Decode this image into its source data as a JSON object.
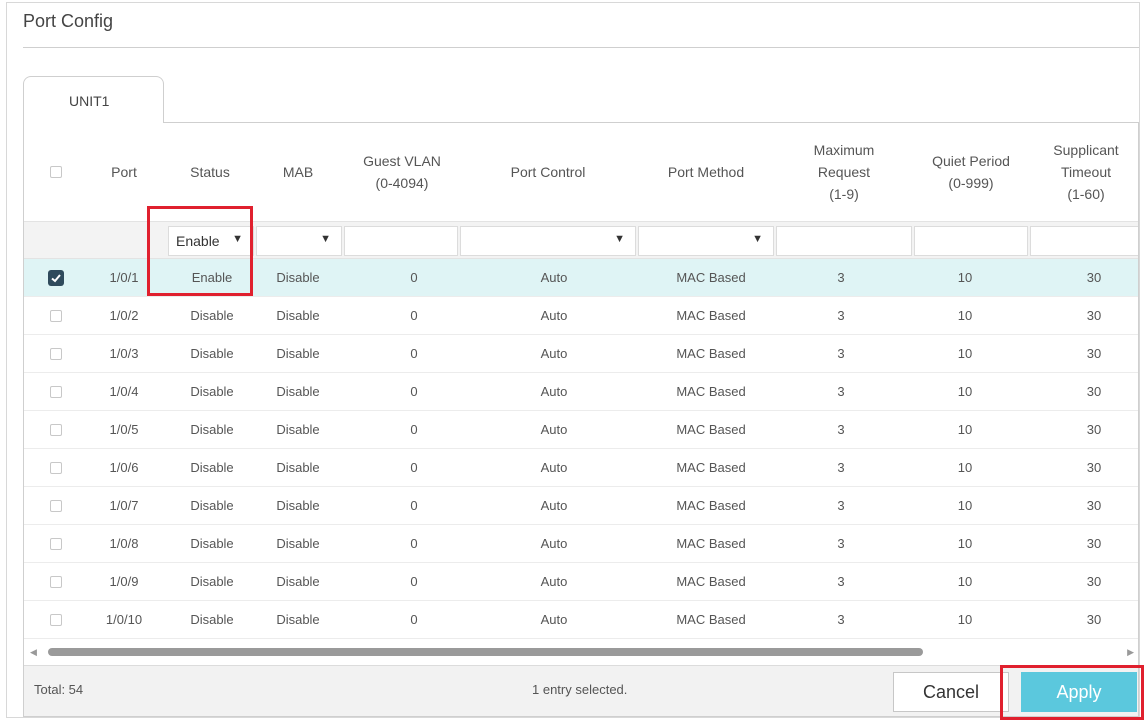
{
  "page": {
    "title": "Port Config"
  },
  "tabs": [
    {
      "label": "UNIT1",
      "active": true
    }
  ],
  "table": {
    "headers": {
      "port": "Port",
      "status": "Status",
      "mab": "MAB",
      "guest_vlan": "Guest VLAN\n(0-4094)",
      "port_control": "Port Control",
      "port_method": "Port Method",
      "max_request": "Maximum\nRequest\n(1-9)",
      "quiet_period": "Quiet Period\n(0-999)",
      "supplicant_timeout": "Supplicant\nTimeout\n(1-60)"
    },
    "filters": {
      "status": "Enable",
      "mab": "",
      "guest_vlan": "",
      "port_control": "",
      "port_method": "",
      "max_request": "",
      "quiet_period": "",
      "supplicant_timeout": ""
    },
    "rows": [
      {
        "checked": true,
        "port": "1/0/1",
        "status": "Enable",
        "mab": "Disable",
        "guest_vlan": "0",
        "port_control": "Auto",
        "port_method": "MAC Based",
        "max_request": "3",
        "quiet_period": "10",
        "supplicant_timeout": "30"
      },
      {
        "checked": false,
        "port": "1/0/2",
        "status": "Disable",
        "mab": "Disable",
        "guest_vlan": "0",
        "port_control": "Auto",
        "port_method": "MAC Based",
        "max_request": "3",
        "quiet_period": "10",
        "supplicant_timeout": "30"
      },
      {
        "checked": false,
        "port": "1/0/3",
        "status": "Disable",
        "mab": "Disable",
        "guest_vlan": "0",
        "port_control": "Auto",
        "port_method": "MAC Based",
        "max_request": "3",
        "quiet_period": "10",
        "supplicant_timeout": "30"
      },
      {
        "checked": false,
        "port": "1/0/4",
        "status": "Disable",
        "mab": "Disable",
        "guest_vlan": "0",
        "port_control": "Auto",
        "port_method": "MAC Based",
        "max_request": "3",
        "quiet_period": "10",
        "supplicant_timeout": "30"
      },
      {
        "checked": false,
        "port": "1/0/5",
        "status": "Disable",
        "mab": "Disable",
        "guest_vlan": "0",
        "port_control": "Auto",
        "port_method": "MAC Based",
        "max_request": "3",
        "quiet_period": "10",
        "supplicant_timeout": "30"
      },
      {
        "checked": false,
        "port": "1/0/6",
        "status": "Disable",
        "mab": "Disable",
        "guest_vlan": "0",
        "port_control": "Auto",
        "port_method": "MAC Based",
        "max_request": "3",
        "quiet_period": "10",
        "supplicant_timeout": "30"
      },
      {
        "checked": false,
        "port": "1/0/7",
        "status": "Disable",
        "mab": "Disable",
        "guest_vlan": "0",
        "port_control": "Auto",
        "port_method": "MAC Based",
        "max_request": "3",
        "quiet_period": "10",
        "supplicant_timeout": "30"
      },
      {
        "checked": false,
        "port": "1/0/8",
        "status": "Disable",
        "mab": "Disable",
        "guest_vlan": "0",
        "port_control": "Auto",
        "port_method": "MAC Based",
        "max_request": "3",
        "quiet_period": "10",
        "supplicant_timeout": "30"
      },
      {
        "checked": false,
        "port": "1/0/9",
        "status": "Disable",
        "mab": "Disable",
        "guest_vlan": "0",
        "port_control": "Auto",
        "port_method": "MAC Based",
        "max_request": "3",
        "quiet_period": "10",
        "supplicant_timeout": "30"
      },
      {
        "checked": false,
        "port": "1/0/10",
        "status": "Disable",
        "mab": "Disable",
        "guest_vlan": "0",
        "port_control": "Auto",
        "port_method": "MAC Based",
        "max_request": "3",
        "quiet_period": "10",
        "supplicant_timeout": "30"
      }
    ]
  },
  "footer": {
    "total": "Total: 54",
    "selection": "1 entry selected.",
    "cancel_label": "Cancel",
    "apply_label": "Apply"
  },
  "icons": {
    "dropdown": "chevron-down-icon",
    "checkbox": "checkbox-icon",
    "scroll_left": "scroll-left-arrow-icon",
    "scroll_right": "scroll-right-arrow-icon"
  },
  "colors": {
    "accent": "#5bc8dd",
    "selected_row": "#dff4f5",
    "highlight": "#e0202e",
    "checkbox_checked": "#2f4a5c"
  }
}
